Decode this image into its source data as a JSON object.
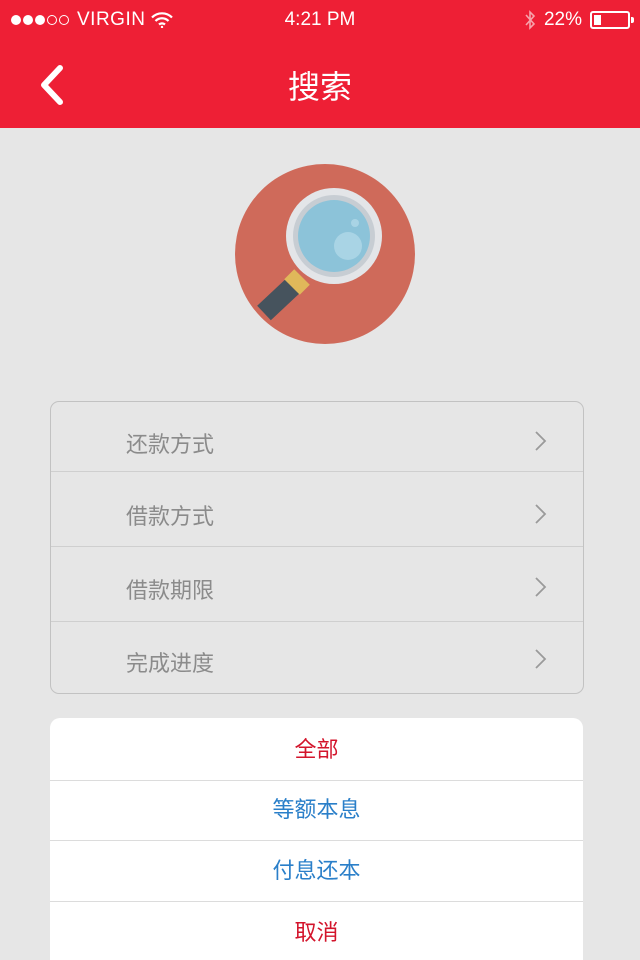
{
  "status_bar": {
    "carrier": "VIRGIN",
    "time": "4:21 PM",
    "battery": "22%",
    "battery_level": 0.22,
    "signal_bars": 3,
    "signal_total": 5
  },
  "nav": {
    "title": "搜索",
    "back_icon": "chevron-left-icon"
  },
  "hero": {
    "icon": "magnifier-icon"
  },
  "filters": [
    {
      "label": "还款方式"
    },
    {
      "label": "借款方式"
    },
    {
      "label": "借款期限"
    },
    {
      "label": "完成进度"
    }
  ],
  "action_sheet": {
    "items": [
      {
        "label": "全部",
        "color": "#d3142b"
      },
      {
        "label": "等额本息",
        "color": "#2a7fc9"
      },
      {
        "label": "付息还本",
        "color": "#2a7fc9"
      },
      {
        "label": "取消",
        "color": "#d3142b"
      }
    ]
  },
  "colors": {
    "brand_red": "#ee1f35",
    "background": "#e6e6e6",
    "label_gray": "#8b8b8b",
    "option_blue": "#2a7fc9"
  }
}
